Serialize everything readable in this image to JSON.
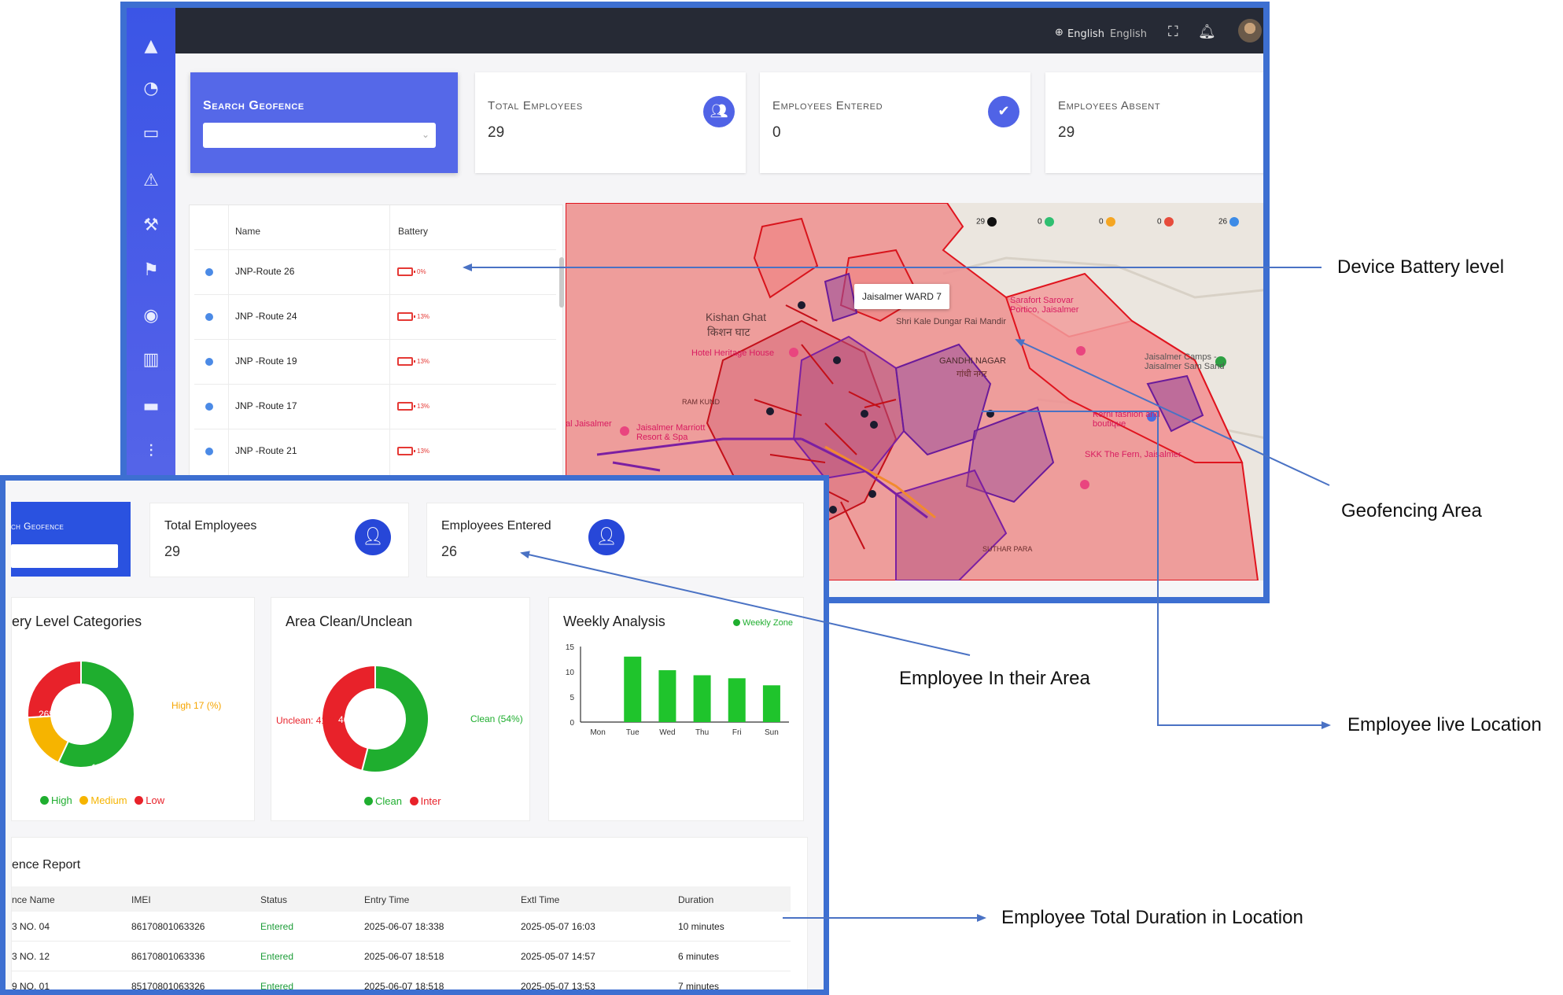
{
  "top": {
    "header": {
      "language_label": "English",
      "language_value": "English"
    },
    "search": {
      "title": "Search Geofence",
      "value": ""
    },
    "stats": [
      {
        "title": "Total Employees",
        "value": "29",
        "icon": "users-icon"
      },
      {
        "title": "Employees Entered",
        "value": "0",
        "icon": "user-check-icon"
      },
      {
        "title": "Employees Absent",
        "value": "29"
      }
    ],
    "table": {
      "headers": {
        "name": "Name",
        "battery": "Battery"
      },
      "rows": [
        {
          "name": "JNP-Route 26",
          "battery": "0%"
        },
        {
          "name": "JNP -Route 24",
          "battery": "13%"
        },
        {
          "name": "JNP -Route 19",
          "battery": "13%"
        },
        {
          "name": "JNP -Route 17",
          "battery": "13%"
        },
        {
          "name": "JNP -Route 21",
          "battery": "13%"
        }
      ]
    },
    "map": {
      "tooltip": "Jaisalmer WARD 7",
      "legend": [
        {
          "count": "29",
          "color": "#111111"
        },
        {
          "count": "0",
          "color": "#2fbf71"
        },
        {
          "count": "0",
          "color": "#f5a623"
        },
        {
          "count": "0",
          "color": "#e74c3c"
        },
        {
          "count": "26",
          "color": "#3d8be6"
        }
      ],
      "labels": {
        "kishan_ghat": "Kishan Ghat",
        "kishan_ghat_hi": "किशन घाट",
        "hotel_heritage": "Hotel Heritage House",
        "gandhi_nagar": "GANDHI NAGAR",
        "gandhi_nagar_hi": "गांधी नगर",
        "sarafort": "Sarafort Sarovar Portico, Jaisalmer",
        "jaisalmer_camps": "Jaisalmer Camps - Jaisalmer Sam Sand",
        "ram_kund": "RAM KUND",
        "marriott": "Jaisalmer Marriott Resort & Spa",
        "skk": "SKK The Fern, Jaisalmer",
        "kerni": "Kerni fashion and boutique",
        "suthar_para": "SUTHAR PARA",
        "kale_dungar": "Shri Kale Dungar Rai Mandir",
        "al_jaisalmer": "al Jaisalmer"
      }
    }
  },
  "bottom": {
    "search": {
      "title": "ch Geofence"
    },
    "stats": [
      {
        "title": "Total Employees",
        "value": "29"
      },
      {
        "title": "Employees Entered",
        "value": "26"
      }
    ],
    "battery_chart": {
      "title": "ery Level Categories",
      "labels": {
        "high_pct": "57%",
        "low_pct": "26%",
        "medium_pct": "17%",
        "high_note": "High 17 (%)"
      },
      "legend": [
        "High",
        "Medium",
        "Low"
      ]
    },
    "area_chart": {
      "title": "Area Clean/Unclean",
      "labels": {
        "clean_pct": "54%",
        "unclean_pct": "46%",
        "clean_note": "Clean (54%)",
        "unclean_note": "Unclean: 416)"
      },
      "legend": [
        "Clean",
        "Inter"
      ]
    },
    "weekly_chart": {
      "title": "Weekly Analysis",
      "legend": "Weekly Zone"
    },
    "report": {
      "title": "ence Report",
      "headers": [
        "nce Name",
        "IMEI",
        "Status",
        "Entry Time",
        "Extl Time",
        "Duration"
      ],
      "rows": [
        [
          "3 NO. 04",
          "86170801063326",
          "Entered",
          "2025-06-07 18:338",
          "2025-05-07 16:03",
          "10 minutes"
        ],
        [
          "3 NO. 12",
          "86170801063336",
          "Entered",
          "2025-06-07 18:518",
          "2025-05-07 14:57",
          "6 minutes"
        ],
        [
          "9 NO. 01",
          "85170801063326",
          "Entered",
          "2025-06-07 18:518",
          "2025-05-07 13:53",
          "7 minutes"
        ]
      ]
    }
  },
  "chart_data": [
    {
      "type": "pie",
      "title": "ery Level Categories",
      "categories": [
        "High",
        "Medium",
        "Low"
      ],
      "values": [
        57,
        17,
        26
      ],
      "colors": [
        "#1fae2f",
        "#f6b400",
        "#e8222a"
      ]
    },
    {
      "type": "pie",
      "title": "Area Clean/Unclean",
      "categories": [
        "Clean",
        "Unclean"
      ],
      "values": [
        54,
        46
      ],
      "colors": [
        "#1fae2f",
        "#e8222a"
      ]
    },
    {
      "type": "bar",
      "title": "Weekly Analysis",
      "categories": [
        "Mon",
        "Tue",
        "Wed",
        "Thu",
        "Fri",
        "Sun"
      ],
      "series": [
        {
          "name": "Weekly Zone",
          "values": [
            0,
            13,
            10.3,
            9.3,
            8.7,
            7.3
          ]
        }
      ],
      "yticks": [
        0,
        5,
        10,
        15
      ],
      "ylim": [
        0,
        15
      ],
      "legend": "top-right",
      "color": "#1fc42c"
    }
  ],
  "annotations": [
    "Device Battery level",
    "Geofencing Area",
    "Employee In their Area",
    "Employee live Location",
    "Employee Total Duration in Location"
  ]
}
